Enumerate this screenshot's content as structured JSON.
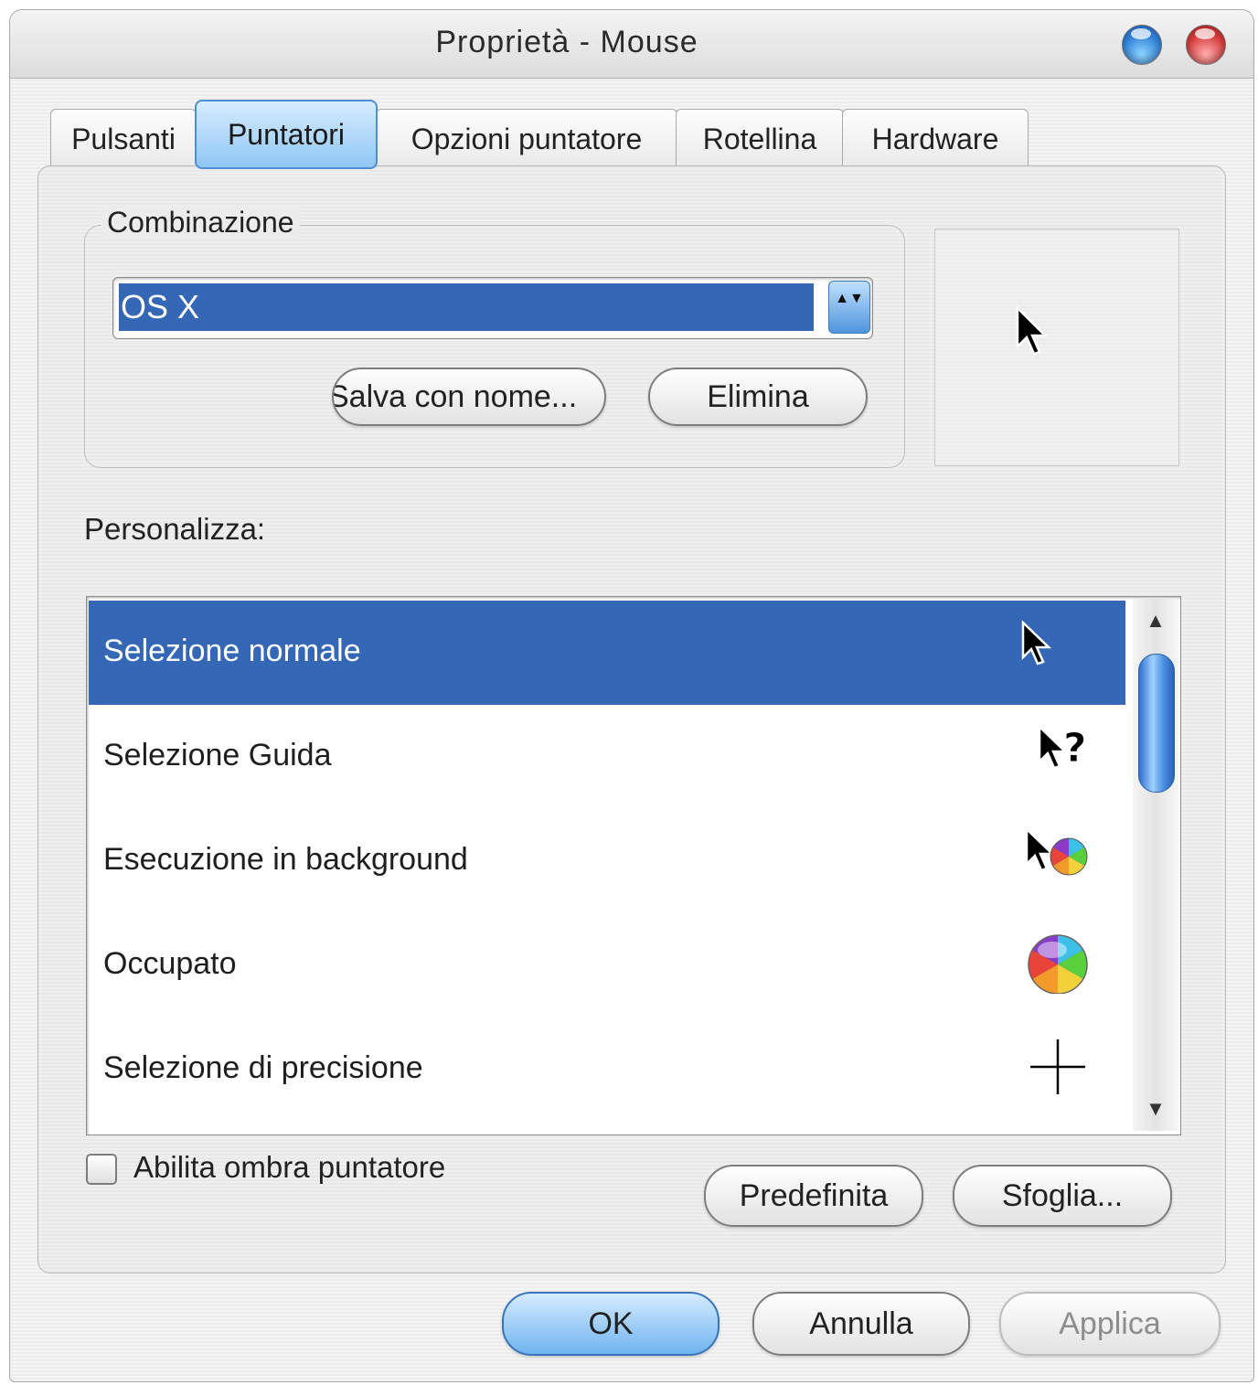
{
  "window": {
    "title": "Proprietà - Mouse"
  },
  "tabs": [
    {
      "label": "Pulsanti"
    },
    {
      "label": "Puntatori",
      "active": true
    },
    {
      "label": "Opzioni puntatore"
    },
    {
      "label": "Rotellina"
    },
    {
      "label": "Hardware"
    }
  ],
  "scheme": {
    "legend": "Combinazione",
    "selected": "OS X",
    "arrows": "▲▼",
    "save_as_label": "Salva con nome...",
    "delete_label": "Elimina"
  },
  "customize": {
    "label": "Personalizza:",
    "items": [
      {
        "label": "Selezione normale",
        "icon": "arrow-cursor-icon",
        "selected": true
      },
      {
        "label": "Selezione Guida",
        "icon": "help-cursor-icon"
      },
      {
        "label": "Esecuzione in background",
        "icon": "working-in-background-cursor-icon"
      },
      {
        "label": "Occupato",
        "icon": "busy-spinner-cursor-icon"
      },
      {
        "label": "Selezione di precisione",
        "icon": "crosshair-cursor-icon"
      }
    ],
    "scroll_up": "▲",
    "scroll_down": "▼"
  },
  "shadow_checkbox": {
    "label": "Abilita ombra puntatore",
    "checked": false
  },
  "buttons": {
    "default_label": "Predefinita",
    "browse_label": "Sfoglia...",
    "ok_label": "OK",
    "cancel_label": "Annulla",
    "apply_label": "Applica"
  },
  "colors": {
    "selection": "#3467b6",
    "accent_blue": "#8fc7f4"
  }
}
